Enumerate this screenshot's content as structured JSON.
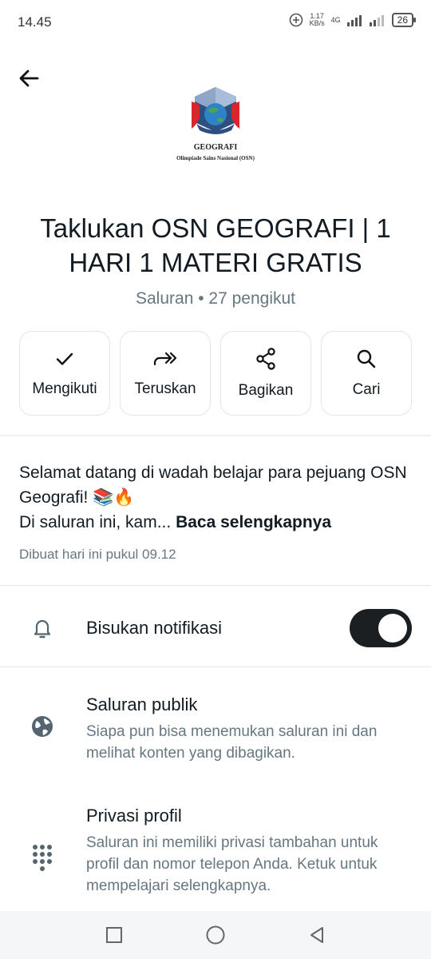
{
  "status": {
    "time": "14.45",
    "speed_value": "1.17",
    "speed_unit": "KB/s",
    "network": "4G",
    "battery": "26"
  },
  "channel": {
    "logo_title": "GEOGRAFI",
    "logo_subtitle": "Olimpiade Sains Nasional (OSN)",
    "name": "Taklukan OSN GEOGRAFI | 1 HARI 1 MATERI GRATIS",
    "meta": "Saluran • 27 pengikut"
  },
  "actions": [
    {
      "label": "Mengikuti",
      "icon": "check-icon"
    },
    {
      "label": "Teruskan",
      "icon": "forward-icon"
    },
    {
      "label": "Bagikan",
      "icon": "share-icon"
    },
    {
      "label": "Cari",
      "icon": "search-icon"
    }
  ],
  "description": {
    "line1": "Selamat datang di wadah belajar para pejuang OSN Geografi! 📚🔥",
    "line2": "Di saluran ini, kam... ",
    "more": "Baca selengkapnya",
    "created": "Dibuat hari ini pukul 09.12"
  },
  "settings": {
    "mute": {
      "label": "Bisukan notifikasi",
      "icon": "bell-icon",
      "toggle_on": true
    },
    "public": {
      "title": "Saluran publik",
      "subtitle": "Siapa pun bisa menemukan saluran ini dan melihat konten yang dibagikan.",
      "icon": "globe-icon"
    },
    "privacy": {
      "title": "Privasi profil",
      "subtitle": "Saluran ini memiliki privasi tambahan untuk profil dan nomor telepon Anda. Ketuk untuk mempelajari selengkapnya.",
      "icon": "dialpad-icon"
    }
  },
  "colors": {
    "toggle_on": "#1b1f22",
    "secondary_text": "#667781"
  }
}
